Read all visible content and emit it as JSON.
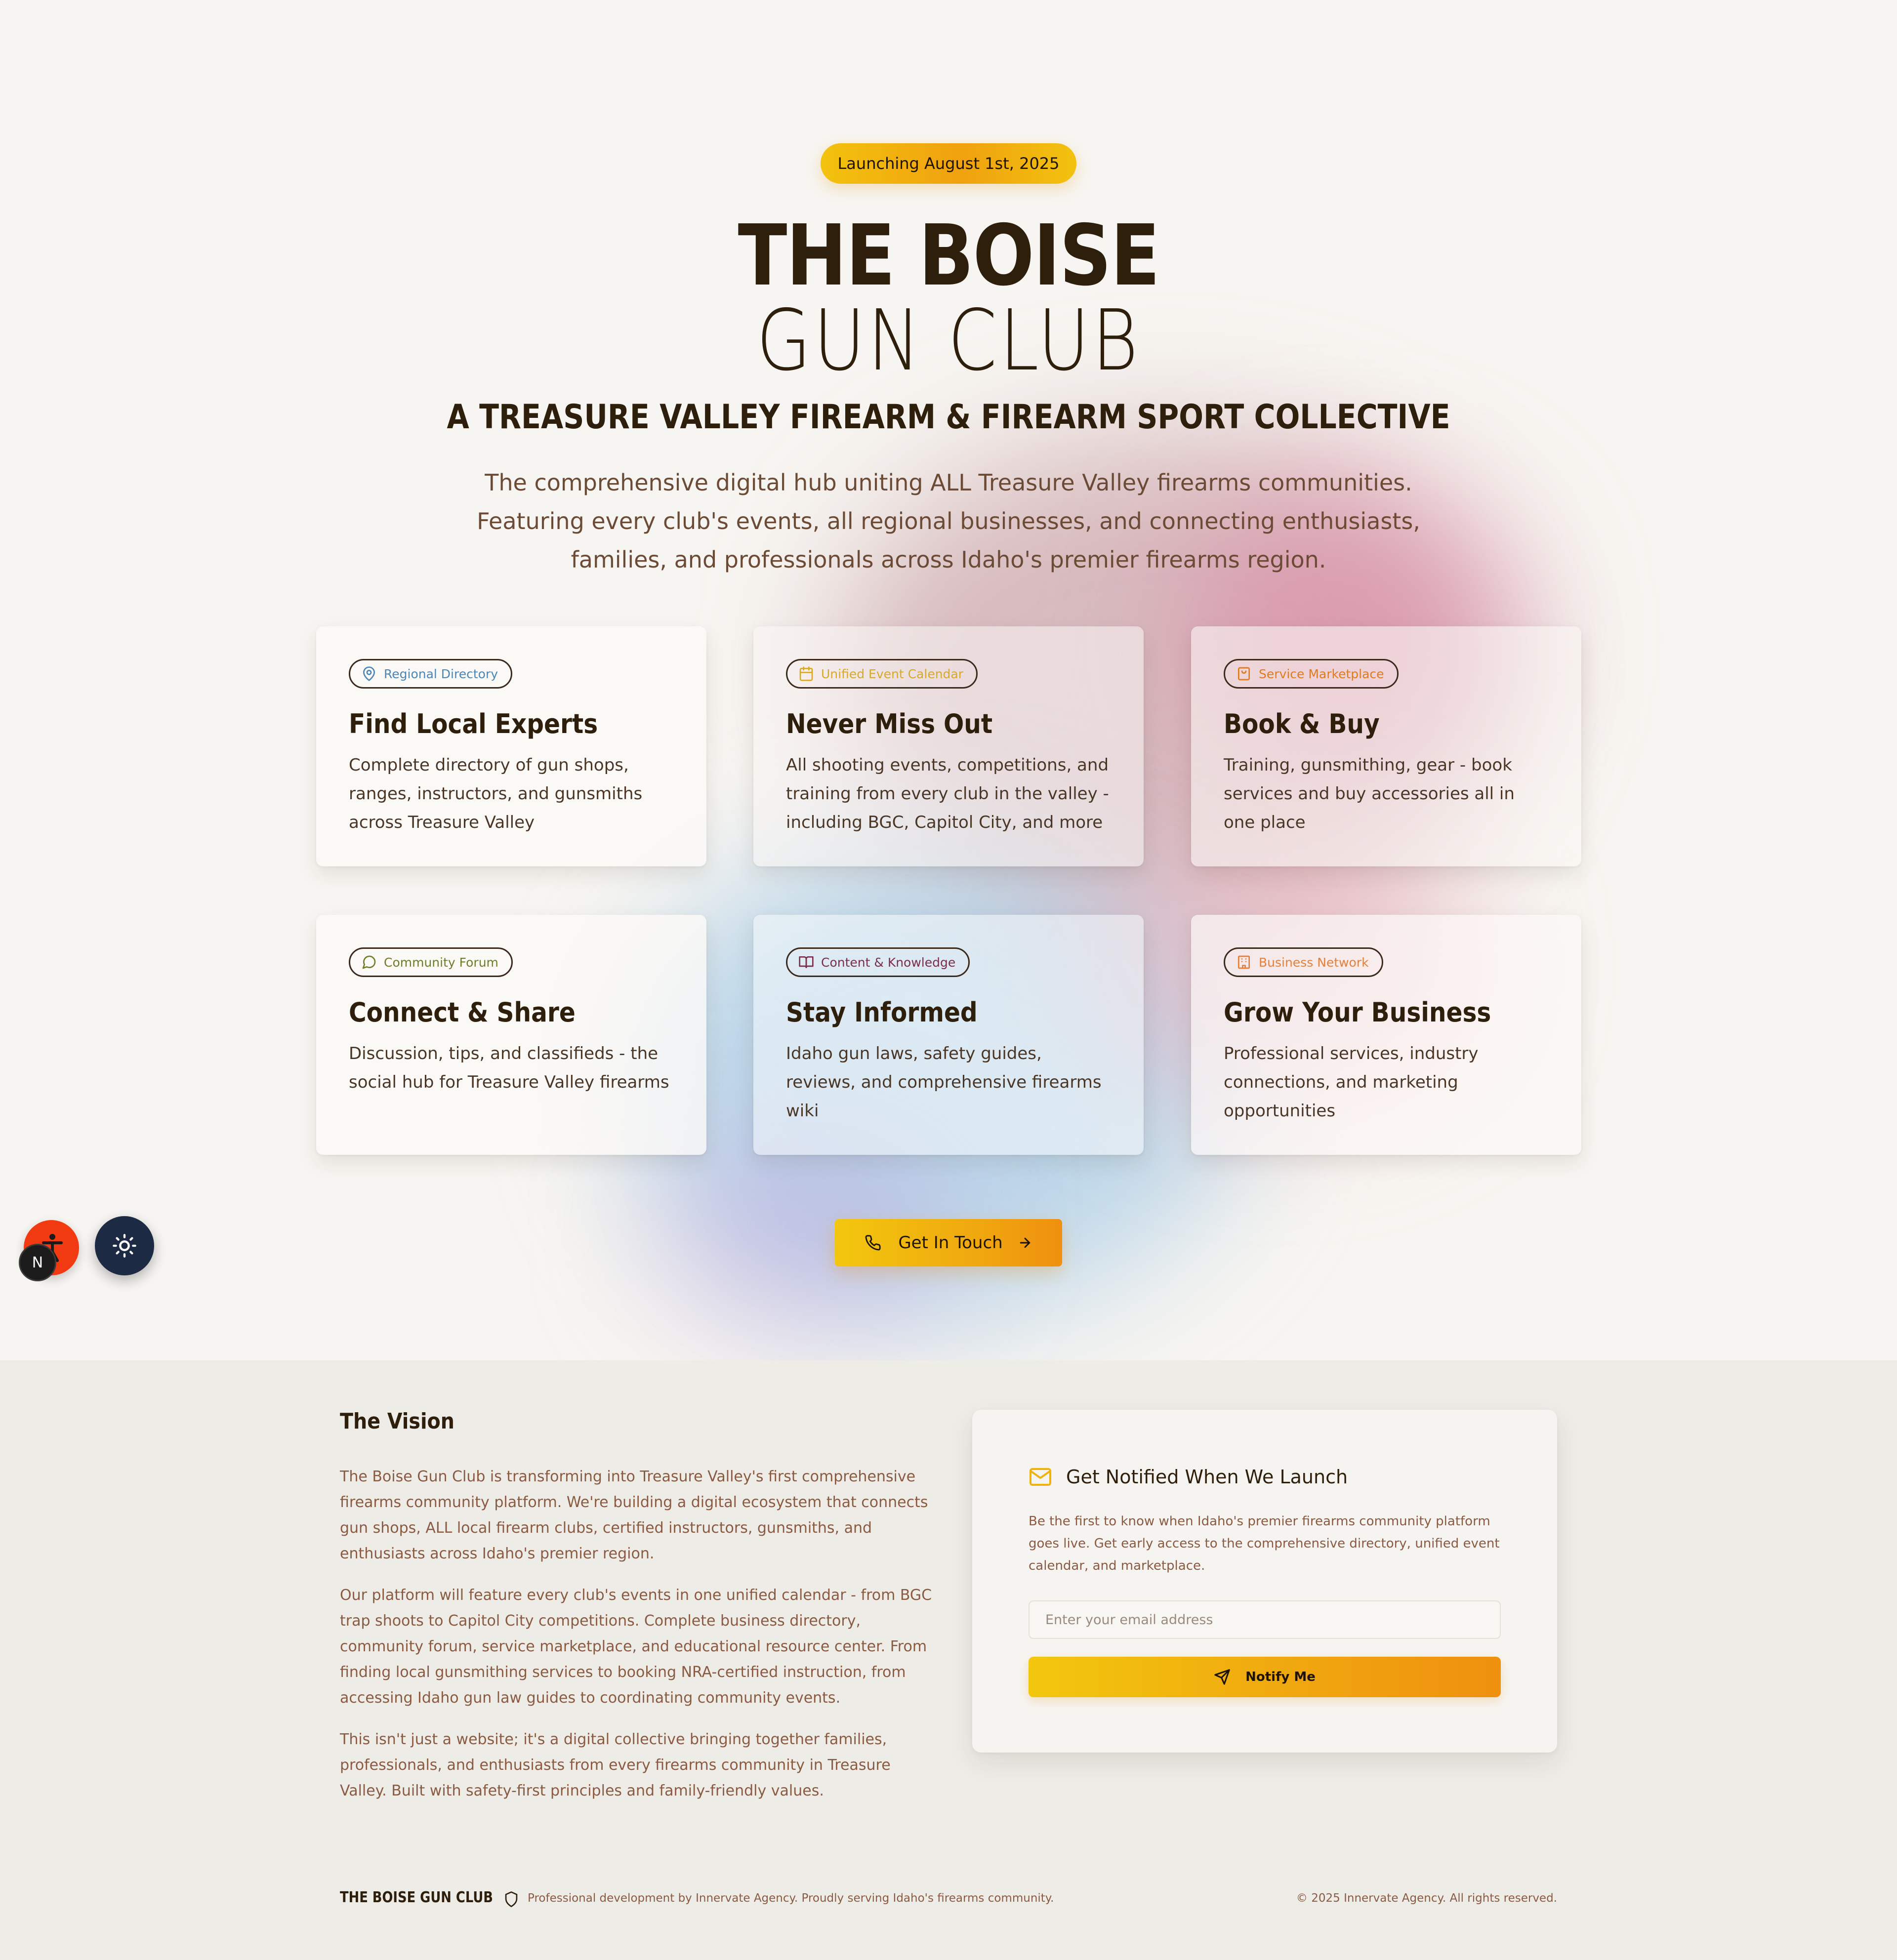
{
  "hero": {
    "badge": "Launching August 1st, 2025",
    "title_bold": "THE BOISE",
    "title_light": "GUN CLUB",
    "subtitle": "A TREASURE VALLEY FIREARM & FIREARM SPORT COLLECTIVE",
    "lead": "The comprehensive digital hub uniting ALL Treasure Valley firearms communities. Featuring every club's events, all regional businesses, and connecting enthusiasts, families, and professionals across Idaho's premier firearms region."
  },
  "cards": [
    {
      "tag": "Regional Directory",
      "icon": "map-pin-icon",
      "title": "Find Local Experts",
      "body": "Complete directory of gun shops, ranges, instructors, and gunsmiths across Treasure Valley"
    },
    {
      "tag": "Unified Event Calendar",
      "icon": "calendar-icon",
      "title": "Never Miss Out",
      "body": "All shooting events, competitions, and training from every club in the valley - including BGC, Capitol City, and more"
    },
    {
      "tag": "Service Marketplace",
      "icon": "shopping-bag-icon",
      "title": "Book & Buy",
      "body": "Training, gunsmithing, gear - book services and buy accessories all in one place"
    },
    {
      "tag": "Community Forum",
      "icon": "chat-bubble-icon",
      "title": "Connect & Share",
      "body": "Discussion, tips, and classifieds - the social hub for Treasure Valley firearms"
    },
    {
      "tag": "Content & Knowledge",
      "icon": "book-open-icon",
      "title": "Stay Informed",
      "body": "Idaho gun laws, safety guides, reviews, and comprehensive firearms wiki"
    },
    {
      "tag": "Business Network",
      "icon": "building-icon",
      "title": "Grow Your Business",
      "body": "Professional services, industry connections, and marketing opportunities"
    }
  ],
  "cta": {
    "label": "Get In Touch"
  },
  "widgets": {
    "nextjs_badge": "N"
  },
  "vision": {
    "heading": "The Vision",
    "paragraphs": [
      "The Boise Gun Club is transforming into Treasure Valley's first comprehensive firearms community platform. We're building a digital ecosystem that connects gun shops, ALL local firearm clubs, certified instructors, gunsmiths, and enthusiasts across Idaho's premier region.",
      "Our platform will feature every club's events in one unified calendar - from BGC trap shoots to Capitol City competitions. Complete business directory, community forum, service marketplace, and educational resource center. From finding local gunsmithing services to booking NRA-certified instruction, from accessing Idaho gun law guides to coordinating community events.",
      "This isn't just a website; it's a digital collective bringing together families, professionals, and enthusiasts from every firearms community in Treasure Valley. Built with safety-first principles and family-friendly values."
    ]
  },
  "notify": {
    "heading": "Get Notified When We Launch",
    "description": "Be the first to know when Idaho's premier firearms community platform goes live. Get early access to the comprehensive directory, unified event calendar, and marketplace.",
    "email_placeholder": "Enter your email address",
    "email_value": "",
    "button_label": "Notify Me"
  },
  "footer": {
    "brand": "THE BOISE GUN CLUB",
    "note": "Professional development by Innervate Agency. Proudly serving Idaho's firearms community.",
    "copyright": "© 2025 Innervate Agency. All rights reserved."
  },
  "colors": {
    "text_dark": "#2e1e0c",
    "accent_yellow": "#f3c20e",
    "accent_orange": "#ef900f",
    "muted_brown": "#8a5a42",
    "page_bg": "#f7f5f1",
    "lower_bg": "#eeece7",
    "theme_button": "#1d2a44",
    "accessibility_button": "#f23a12"
  }
}
